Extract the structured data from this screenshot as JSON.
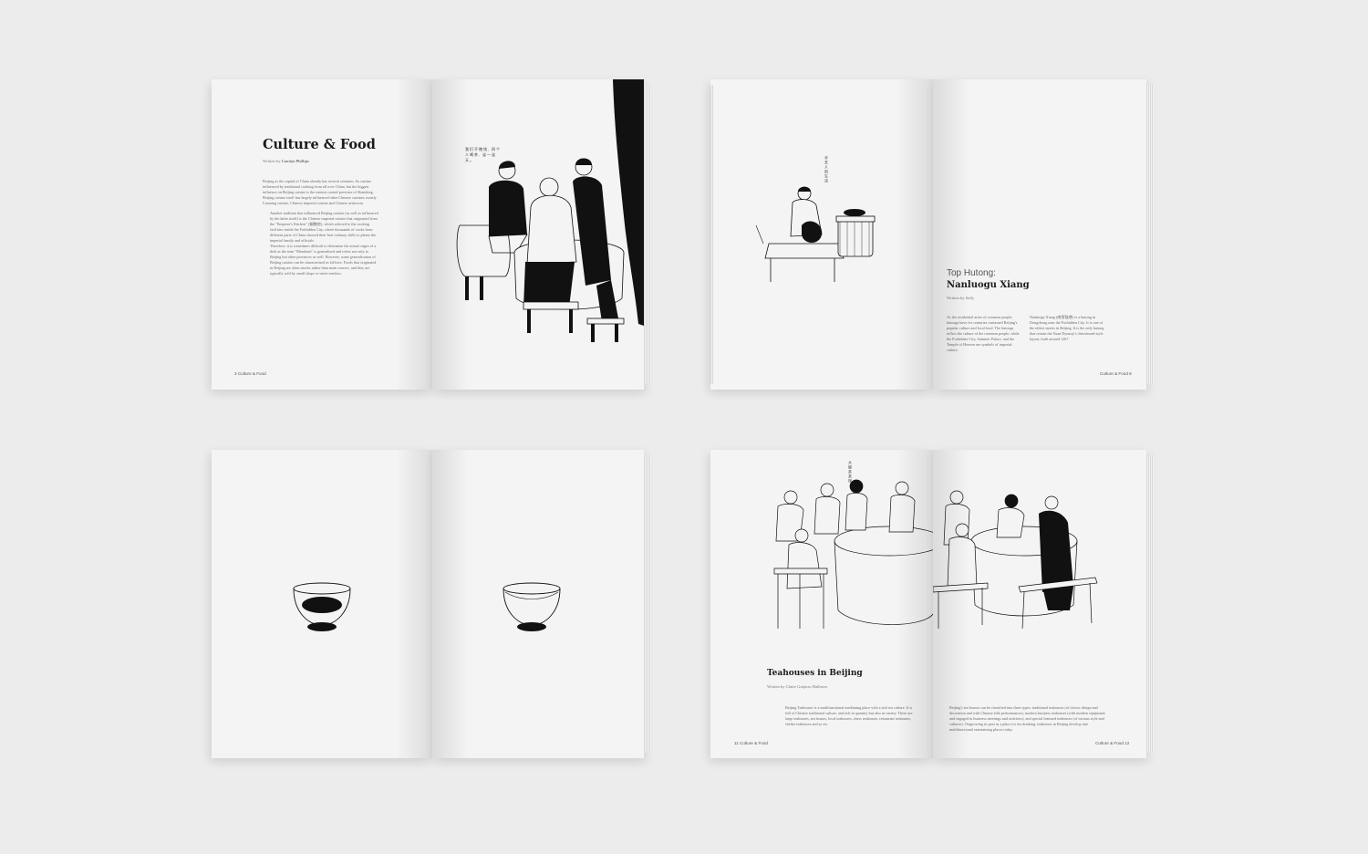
{
  "spread_1": {
    "title": "Culture & Food",
    "byline_prefix": "Written by ",
    "byline_author": "Carolyn Phillips",
    "paragraphs": [
      "Beijing as the capital of China already has several centuries. Its cuisine influenced by traditional cooking from all over China, but the biggest influence on Beijing cuisine is the eastern coastal province of Shandong. Beijing cuisine itself has largely influenced other Chinese cuisines, mostly Liaoning cuisine, Chinese imperial cuisine and Chinese aristocrat.",
      "Another tradition that influenced Beijing cuisine (as well as influenced by the latter itself) is the Chinese imperial cuisine that originated from the \"Emperor's Kitchen\" (御膳房), which referred to the cooking facilities inside the Forbidden City, where thousands of cooks from different parts of China showed their best culinary skills to please the imperial family and officials.",
      "Therefore, it is sometimes difficult to determine the actual origin of a dish as the term \"Mandarin\" is generalised and refers not only to Beijing but other provinces as well. However, some generalisation of Beijing cuisine can be characterised as follows: Foods that originated in Beijing are often snacks rather than main courses, and they are typically sold by small shops or street vendors."
    ],
    "folio": "3 Culture & Food",
    "handwriting": "我们不赌钱, 四个人喝茶, 谈一谈天。"
  },
  "spread_2": {
    "heading_light": "Top Hutong:",
    "heading_bold": "Nanluogu Xiang",
    "byline": "Written by Sally",
    "col1": "As the residential areas of common people, hutongs have for centuries contained Beijing's popular culture and local food. The hutongs reflect the culture of the common people, while the Forbidden City, Summer Palace, and the Temple of Heaven are symbols of imperial culture.",
    "col2": "Nanluogu Xiang (南锣鼓巷) is a hutong in Dongcheng near the Forbidden City. It is one of the oldest streets in Beijing. It is the only hutong that retains the Yuan Dynasty's chessboard-style layout, built around 1267.",
    "folio": "Culture & Food 8",
    "vertical_caption": "手艺人的生活"
  },
  "spread_4": {
    "title": "Teahouses in Beijing",
    "byline": "Written by Claire Guijarro Ballester",
    "col1": "Beijing Teahouses is a multifunctional meditating place with a rich tea culture. It is full of Chinese traditional culture, and rich in quantity but also in variety. There are large teahouses, tea houses, local teahouses, chess teahouses, restaurant teahouses, shelter teahouses and so on.",
    "col2": "Beijing's tea houses can be classified into three types: traditional teahouses (of classic design and decoration and with Chinese folk performances), modern business teahouses (with modern equipment and engaged in business meetings and activities), and special featured teahouses (of various style and cultures). Outgrowing its past as a place for tea drinking, teahouses in Beijing develop into multifunctional entertaining places today.",
    "folio_left": "11 Culture & Food",
    "folio_right": "Culture & Food 12",
    "vertical_caption": "大碗茶茶馆"
  },
  "colors": {
    "background": "#ececec",
    "paper": "#f4f4f4",
    "ink": "#111111"
  }
}
